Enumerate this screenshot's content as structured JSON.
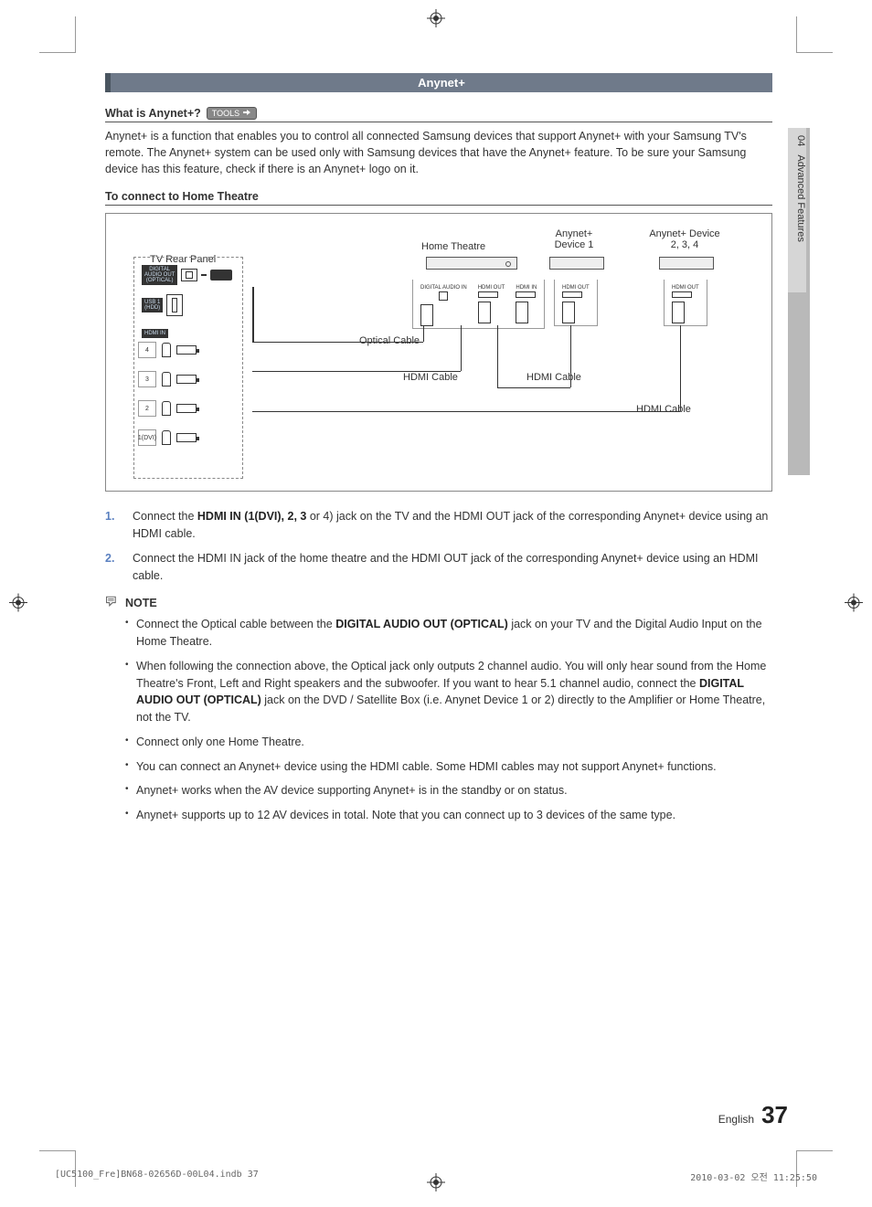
{
  "sidebar": {
    "chapter": "04",
    "title": "Advanced Features"
  },
  "sectionBar": "Anynet+",
  "h3_what": "What is Anynet+?",
  "tools_label": "TOOLS",
  "intro": "Anynet+ is a function that enables you to control all connected Samsung devices that support Anynet+ with your Samsung TV's remote. The Anynet+ system can be used only with Samsung devices that have the Anynet+ feature. To be sure your Samsung device has this feature, check if there is an Anynet+ logo on it.",
  "h3_connect": "To connect to Home Theatre",
  "diagram": {
    "tv_panel": "TV Rear Panel",
    "home_theatre": "Home Theatre",
    "dev1": "Anynet+\nDevice 1",
    "dev234": "Anynet+ Device\n2, 3, 4",
    "optical": "Optical Cable",
    "hdmi": "HDMI Cable",
    "digital_out": "DIGITAL\nAUDIO OUT\n(OPTICAL)",
    "usb": "USB 1\n(HDD)",
    "hdmi_in": "HDMI IN",
    "p1dvi": "1(DVI)",
    "digital_in": "DIGITAL AUDIO IN",
    "hdmi_out": "HDMI OUT"
  },
  "steps": [
    {
      "n": "1.",
      "pre": "Connect the ",
      "b": "HDMI IN (1(DVI), 2, 3",
      "post": " or 4) jack on the TV and the HDMI OUT jack of the corresponding Anynet+ device using an HDMI cable."
    },
    {
      "n": "2.",
      "text": "Connect the HDMI IN jack of the home theatre and the HDMI OUT jack of the corresponding Anynet+ device using an HDMI cable."
    }
  ],
  "note_head": "NOTE",
  "notes": {
    "n1_pre": "Connect the Optical cable between the ",
    "n1_b": "DIGITAL AUDIO OUT (OPTICAL)",
    "n1_post": " jack on your TV and the Digital Audio Input on the Home Theatre.",
    "n2_pre": "When following the connection above, the Optical jack only outputs 2 channel audio. You will only hear sound from the Home Theatre's Front, Left and Right speakers and the subwoofer. If you want to hear 5.1 channel audio, connect the ",
    "n2_b": "DIGITAL AUDIO OUT (OPTICAL)",
    "n2_post": " jack on the DVD / Satellite Box (i.e. Anynet Device 1 or 2) directly to the Amplifier or Home Theatre, not the TV.",
    "n3": "Connect only one Home Theatre.",
    "n4": "You can connect an Anynet+ device using the HDMI cable. Some HDMI cables may not support Anynet+ functions.",
    "n5": "Anynet+ works when the AV device supporting Anynet+ is in the standby or on status.",
    "n6": "Anynet+ supports up to 12 AV devices in total. Note that you can connect up to 3 devices of the same type."
  },
  "footer": {
    "lang": "English",
    "page": "37"
  },
  "printfoot": {
    "left": "[UC5100_Fre]BN68-02656D-00L04.indb   37",
    "right": "2010-03-02   오전 11:25:50"
  }
}
